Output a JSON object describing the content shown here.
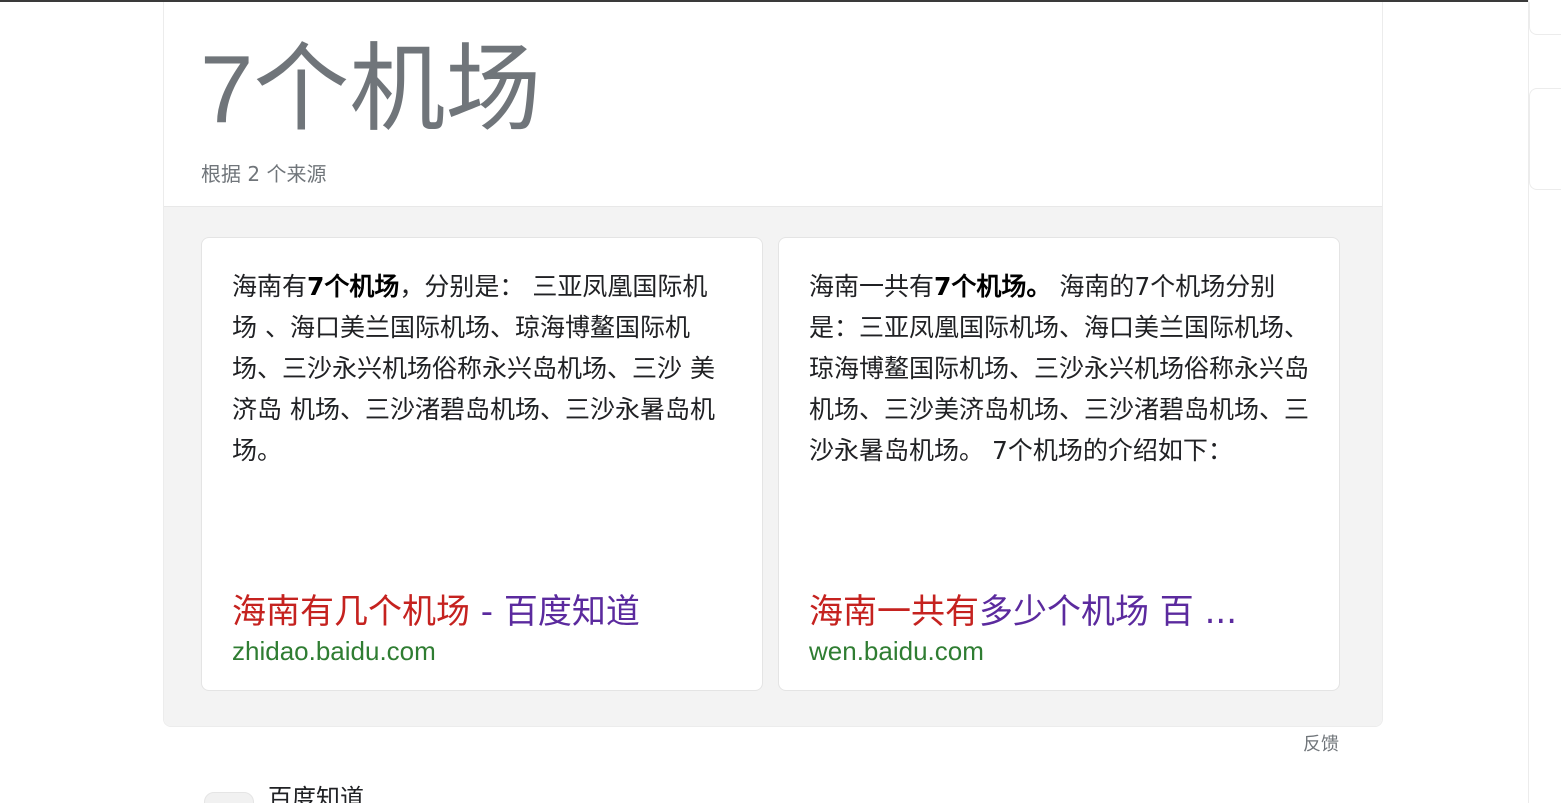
{
  "answer": {
    "title": "7个机场",
    "subtitle": "根据 2 个来源"
  },
  "sources": [
    {
      "snippet_pre": "海南有",
      "snippet_bold": "7个机场",
      "snippet_post": "，分别是： 三亚凤凰国际机场 、海口美兰国际机场、琼海博鳌国际机场、三沙永兴机场俗称永兴岛机场、三沙 美济岛 机场、三沙渚碧岛机场、三沙永暑岛机场。",
      "link_red": "海南有几个机场",
      "link_purple": " - 百度知道",
      "domain": "zhidao.baidu.com"
    },
    {
      "snippet_pre": "海南一共有",
      "snippet_bold": "7个机场。",
      "snippet_post": " 海南的7个机场分别是：三亚凤凰国际机场、海口美兰国际机场、琼海博鳌国际机场、三沙永兴机场俗称永兴岛机场、三沙美济岛机场、三沙渚碧岛机场、三沙永暑岛机场。 7个机场的介绍如下：",
      "link_red": "海南一共有",
      "link_purple": "多少个机场 百 ...",
      "domain": "wen.baidu.com"
    }
  ],
  "feedback_label": "反馈",
  "next_result": {
    "site_name": "百度知道"
  },
  "colors": {
    "title_gray": "#70757a",
    "link_red": "#c5221f",
    "link_purple": "#5b2a9e",
    "domain_green": "#2f7d32",
    "body_bg": "#f3f3f3"
  }
}
